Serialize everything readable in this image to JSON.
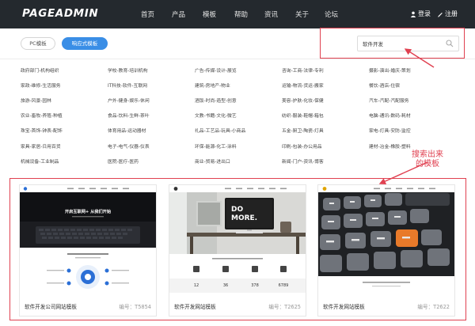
{
  "header": {
    "logo": "PAGEADMIN",
    "nav": [
      "首页",
      "产品",
      "模板",
      "帮助",
      "资讯",
      "关于",
      "论坛"
    ],
    "login": "登录",
    "register": "注册"
  },
  "tabs": [
    "PC模板",
    "响应式模板"
  ],
  "search": {
    "value": "软件开发"
  },
  "categories": [
    [
      "政府部门-机构组织",
      "学校-教育-培训机构",
      "广告-传媒-设计-展览",
      "咨询-工商-法律-专利",
      "摄影-演出-婚庆-策划"
    ],
    [
      "家政-维修-生活服务",
      "IT科技-软件-互联网",
      "建筑-房地产-物业",
      "运输-物流-货运-搬家",
      "餐饮-酒店-住宿"
    ],
    [
      "旅游-风景-园林",
      "户外-健身-娱乐-休闲",
      "酒饭-时尚-造型-创意",
      "美容-护肤-化妆-保健",
      "汽车-汽配-汽配服务"
    ],
    [
      "农业-畜牧-养殖-种植",
      "食品-饮料-生鲜-茶叶",
      "文教-书籍-文化-微艺",
      "纺织-服装-鞋帽-箱包",
      "电脑-通讯-数码-耗材"
    ],
    [
      "珠宝-首饰-钟表-配饰",
      "体育用品-运动器材",
      "礼品-工艺品-玩具-小商品",
      "五金-厨卫-陶瓷-灯具",
      "家电-灯具-安防-监控"
    ],
    [
      "家具-家居-日用百货",
      "电子-电气-仪器-仪表",
      "环保-能源-化工-涂料",
      "印刷-包装-办公用品",
      "建材-冶金-橡胶-塑料"
    ],
    [
      "机械设备-工业制品",
      "医院-医疗-医药",
      "商业-贸易-进出口",
      "新闻-门户-资讯-博客",
      ""
    ]
  ],
  "annotation": [
    "搜索出来",
    "的模板"
  ],
  "cards": [
    {
      "title": "软件开发公司网站模板",
      "code": "编号：T5854",
      "banner": "开启互联网+ 从我们开始"
    },
    {
      "title": "软件开发网站模板",
      "code": "编号：T2625",
      "banner_line1": "DO",
      "banner_line2": "MORE.",
      "stats": [
        "12",
        "36",
        "378",
        "6789"
      ]
    },
    {
      "title": "软件开发网站模板",
      "code": "编号：T2622"
    }
  ],
  "colors": {
    "topbar": "#24292e",
    "accent": "#3a8ee6",
    "annotation": "#e04050"
  }
}
